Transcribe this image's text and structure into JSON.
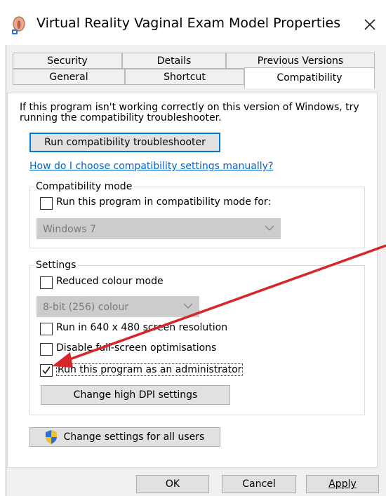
{
  "window": {
    "title": "Virtual Reality Vaginal Exam Model Properties",
    "close_icon": "close-icon",
    "app_icon": "app-icon"
  },
  "tabs": {
    "row1": [
      "Security",
      "Details",
      "Previous Versions"
    ],
    "row2": [
      "General",
      "Shortcut",
      "Compatibility"
    ],
    "active": "Compatibility"
  },
  "intro_text": "If this program isn't working correctly on this version of Windows, try running the compatibility troubleshooter.",
  "troubleshooter_button": "Run compatibility troubleshooter",
  "help_link": "How do I choose compatibility settings manually?",
  "compat_mode": {
    "group_label": "Compatibility mode",
    "checkbox_label": "Run this program in compatibility mode for:",
    "checked": false,
    "select_value": "Windows 7"
  },
  "settings": {
    "group_label": "Settings",
    "reduced_colour": {
      "label": "Reduced colour mode",
      "checked": false
    },
    "colour_select_value": "8-bit (256) colour",
    "res640": {
      "label": "Run in 640 x 480 screen resolution",
      "checked": false
    },
    "fullscreen_opt": {
      "label": "Disable full-screen optimisations",
      "checked": false
    },
    "admin": {
      "label": "Run this program as an administrator",
      "checked": true
    },
    "dpi_button": "Change high DPI settings"
  },
  "all_users_button": "Change settings for all users",
  "footer": {
    "ok": "OK",
    "cancel": "Cancel",
    "apply": "Apply"
  },
  "colors": {
    "accent": "#0078d7",
    "link": "#0066cc",
    "annotation_arrow": "#d6262b",
    "shield_blue": "#2a6fd6",
    "shield_yellow": "#f2c12e"
  }
}
